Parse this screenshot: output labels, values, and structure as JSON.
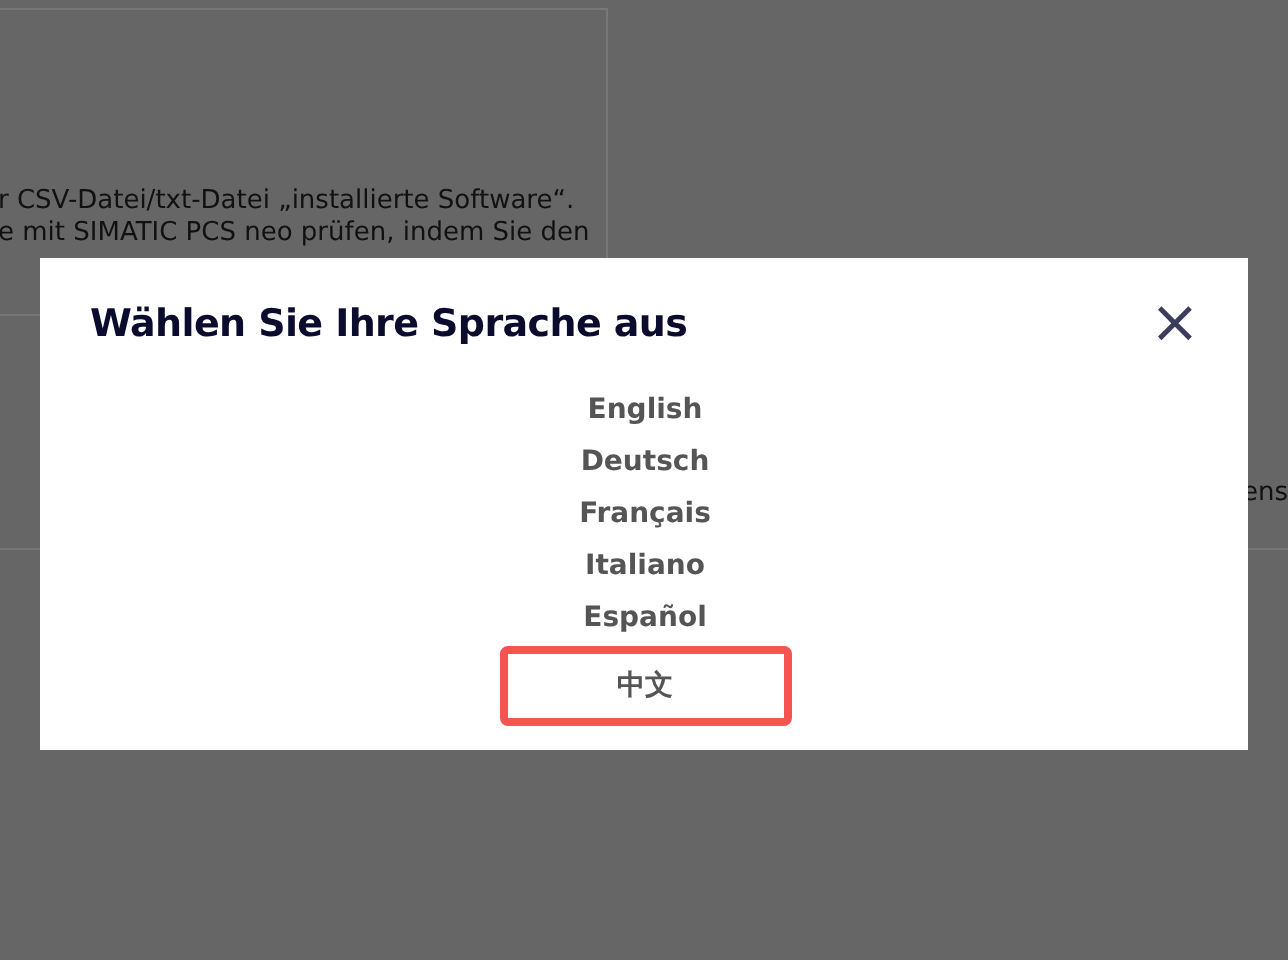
{
  "background": {
    "lines": [
      "r CSV-Datei/txt-Datei „installierte Software“.",
      "e mit SIMATIC PCS neo prüfen, indem Sie den"
    ],
    "side_text": "ens"
  },
  "dialog": {
    "title": "Wählen Sie Ihre Sprache aus",
    "close": "×",
    "languages": [
      {
        "label": "English",
        "highlighted": false
      },
      {
        "label": "Deutsch",
        "highlighted": false
      },
      {
        "label": "Français",
        "highlighted": false
      },
      {
        "label": "Italiano",
        "highlighted": false
      },
      {
        "label": "Español",
        "highlighted": false
      },
      {
        "label": "中文",
        "highlighted": true
      }
    ]
  }
}
